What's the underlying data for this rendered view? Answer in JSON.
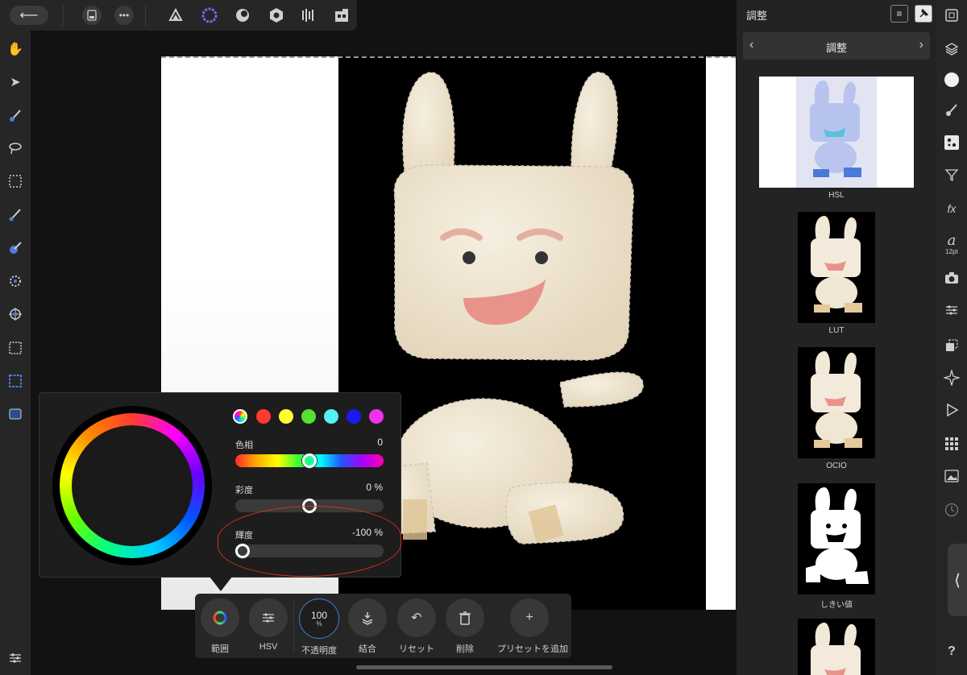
{
  "topbar": {
    "back_icon": "arrow-left-icon",
    "doc_icon": "document-icon",
    "more_icon": "ellipsis-icon",
    "personas": [
      "photo-persona-icon",
      "liquify-persona-icon",
      "develop-persona-icon",
      "tone-mapping-persona-icon",
      "export-persona-icon",
      "share-icon"
    ]
  },
  "left_tools": [
    "hand-icon",
    "move-icon",
    "brush-icon",
    "lasso-icon",
    "marquee-rect-icon",
    "selection-brush-icon",
    "flood-select-icon",
    "sponge-icon",
    "patch-icon",
    "rect-selection-icon",
    "selected-rect-icon",
    "layer-icon",
    "settings-sliders-icon"
  ],
  "hsl_panel": {
    "swatch_colors": [
      "#ff3b30",
      "#ffff33",
      "#55e033",
      "#55f0f0",
      "#1a1aee",
      "#ee33ee"
    ],
    "hue": {
      "label": "色相",
      "value": "0",
      "level": 0.5
    },
    "saturation": {
      "label": "彩度",
      "value": "0 %",
      "level": 0.5
    },
    "luminosity": {
      "label": "輝度",
      "value": "-100 %",
      "level": 0.0
    },
    "annotation_color": "#d0321c"
  },
  "context_bar": {
    "range_label": "範囲",
    "hsv_label": "HSV",
    "opacity_value": "100",
    "opacity_unit": "%",
    "opacity_label": "不透明度",
    "merge_label": "結合",
    "reset_label": "リセット",
    "delete_label": "削除",
    "add_preset_label": "プリセットを追加"
  },
  "right_panel": {
    "title": "調整",
    "section_title": "調整",
    "thumbnails": [
      {
        "label": "HSL"
      },
      {
        "label": "LUT"
      },
      {
        "label": "OCIO"
      },
      {
        "label": "しきい値"
      }
    ]
  },
  "right_strip": {
    "text_size": "12pt",
    "help_label": "?"
  }
}
